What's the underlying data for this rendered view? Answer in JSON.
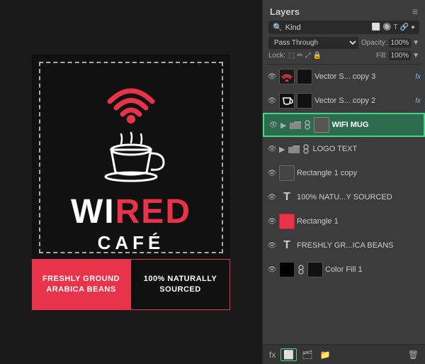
{
  "panel": {
    "title": "Layers",
    "menu_icon": "≡",
    "search": {
      "icon": "🔍",
      "kind_label": "Kind",
      "icons": [
        "⬜",
        "🔘",
        "T",
        "🔗",
        "⚙"
      ]
    },
    "blend_mode": "Pass Through",
    "opacity_label": "Opacity:",
    "opacity_value": "100%",
    "lock_label": "Lock:",
    "lock_icons": [
      "⬜",
      "✏",
      "↔",
      "🔒"
    ],
    "fill_label": "Fill:",
    "fill_value": "100%"
  },
  "layers": [
    {
      "id": 1,
      "visible": true,
      "thumb_type": "wifi",
      "name": "Vector S... copy 3",
      "fx": true,
      "indent": false,
      "folder": false
    },
    {
      "id": 2,
      "visible": true,
      "thumb_type": "mug",
      "name": "Vector S... copy 2",
      "fx": true,
      "indent": false,
      "folder": false
    },
    {
      "id": 3,
      "visible": true,
      "thumb_type": "folder",
      "name": "WIFI MUG",
      "fx": false,
      "indent": false,
      "folder": true,
      "active": true
    },
    {
      "id": 4,
      "visible": true,
      "thumb_type": "folder",
      "name": "LOGO TEXT",
      "fx": false,
      "indent": false,
      "folder": true,
      "active": false
    },
    {
      "id": 5,
      "visible": true,
      "thumb_type": "rect",
      "name": "Rectangle 1 copy",
      "fx": false,
      "indent": false,
      "folder": false
    },
    {
      "id": 6,
      "visible": true,
      "thumb_type": "text",
      "name": "100% NATU...Y SOURCED",
      "fx": false,
      "indent": false,
      "folder": false,
      "text_layer": true
    },
    {
      "id": 7,
      "visible": true,
      "thumb_type": "rect_red",
      "name": "Rectangle 1",
      "fx": false,
      "indent": false,
      "folder": false
    },
    {
      "id": 8,
      "visible": true,
      "thumb_type": "text",
      "name": "FRESHLY GR...ICA BEANS",
      "fx": false,
      "indent": false,
      "folder": false,
      "text_layer": true
    },
    {
      "id": 9,
      "visible": true,
      "thumb_type": "black",
      "name": "Color Fill 1",
      "fx": false,
      "indent": false,
      "folder": false
    }
  ],
  "toolbar": {
    "icons": [
      "fx",
      "⬜",
      "🗂",
      "📁",
      "🗑"
    ]
  },
  "design": {
    "brand_wi": "WI",
    "brand_red": "RED",
    "brand_cafe": "CAFÉ",
    "strip_left": "FRESHLY GROUND\nARABICA BEANS",
    "strip_right": "100% NATURALLY\nSOURCED"
  }
}
